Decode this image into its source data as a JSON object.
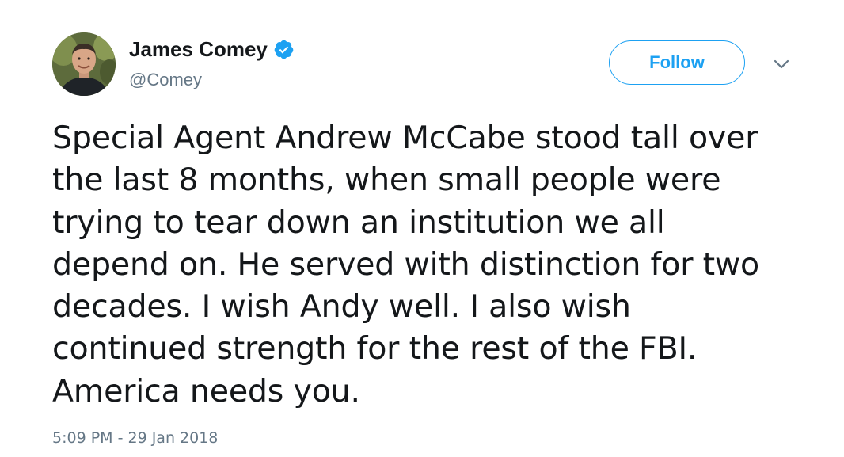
{
  "user": {
    "display_name": "James Comey",
    "handle": "@Comey",
    "verified": true,
    "avatar_icon": "profile-photo"
  },
  "follow_button": {
    "label": "Follow"
  },
  "menu": {
    "icon": "chevron-down-icon"
  },
  "tweet": {
    "lines": [
      "Special Agent Andrew McCabe stood tall over",
      "the last 8 months, when small people were",
      "trying to tear down an institution we all",
      "depend on. He served with distinction for two",
      "decades. I wish Andy well. I also wish",
      "continued strength for the rest of the FBI.",
      "America needs you."
    ],
    "timestamp": "5:09 PM - 29 Jan 2018"
  },
  "colors": {
    "accent": "#1da1f2",
    "text": "#14171a",
    "secondary": "#657786"
  }
}
